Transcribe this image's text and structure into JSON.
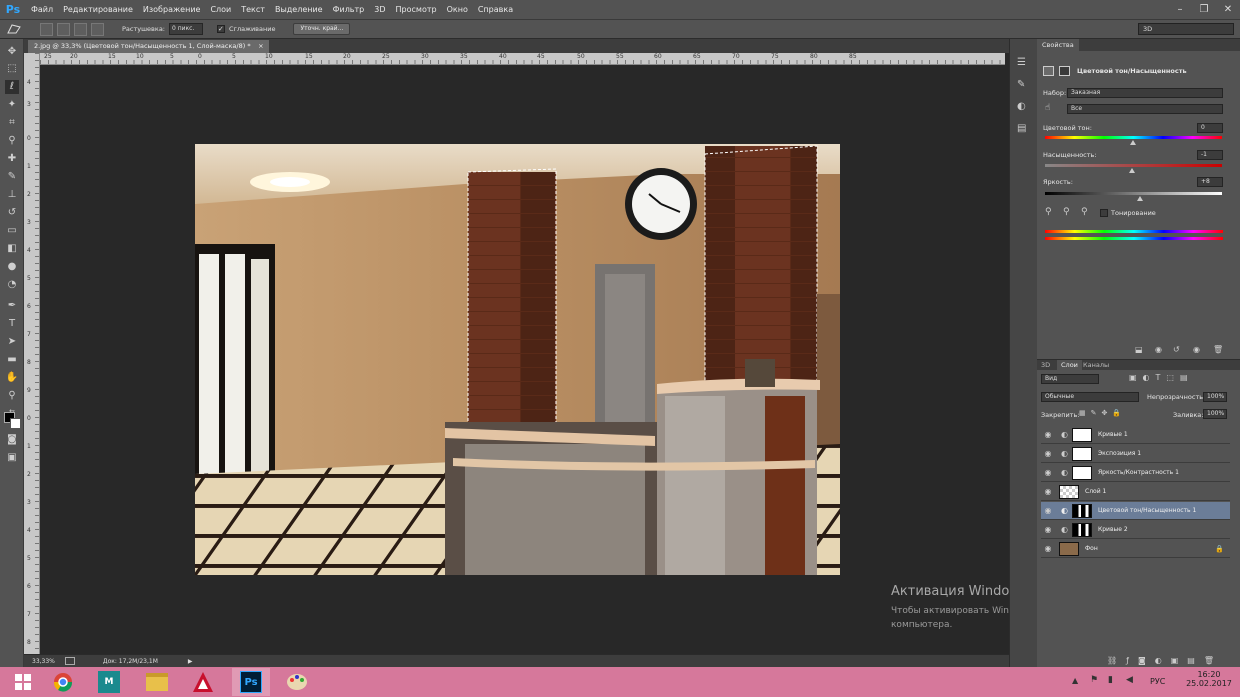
{
  "app": {
    "logo": "Ps",
    "accent": "#31a8ff"
  },
  "menu": [
    "Файл",
    "Редактирование",
    "Изображение",
    "Слои",
    "Текст",
    "Выделение",
    "Фильтр",
    "3D",
    "Просмотр",
    "Окно",
    "Справка"
  ],
  "window_controls": {
    "minimize": "–",
    "restore": "❐",
    "close": "✕"
  },
  "options": {
    "feather_label": "Растушевка:",
    "feather_value": "0 пикс.",
    "antialias_label": "Сглаживание",
    "refine_button": "Уточн. край...",
    "workspace": "3D"
  },
  "document": {
    "tab_title": "2.jpg @ 33,3% (Цветовой тон/Насыщенность 1, Слой-маска/8) *",
    "close": "×"
  },
  "ruler_top_labels": [
    "25",
    "20",
    "15",
    "10",
    "5",
    "0",
    "5",
    "10",
    "15",
    "20",
    "25",
    "30",
    "35",
    "40",
    "45",
    "50",
    "55",
    "60",
    "65",
    "70",
    "75",
    "80",
    "85"
  ],
  "ruler_left_labels": [
    "4",
    "3",
    "0",
    "1",
    "2",
    "3",
    "4",
    "5",
    "6",
    "7",
    "8",
    "9",
    "0",
    "1",
    "2",
    "3",
    "4",
    "5",
    "6",
    "7",
    "8"
  ],
  "status": {
    "zoom": "33,33%",
    "doc": "Док: 17,2M/23,1M",
    "arrow": "▶"
  },
  "properties": {
    "tabs": [
      "Свойства"
    ],
    "header": "Цветовой тон/Насыщенность",
    "preset_label": "Набор:",
    "preset_value": "Заказная",
    "channel_value": "Все",
    "hue_label": "Цветовой тон:",
    "hue_value": "0",
    "saturation_label": "Насыщенность:",
    "saturation_value": "-1",
    "lightness_label": "Яркость:",
    "lightness_value": "+8",
    "colorize_label": "Тонирование"
  },
  "layers_panel": {
    "tabs": [
      "3D",
      "Слои",
      "Каналы"
    ],
    "filter_value": "Вид",
    "blend_mode": "Обычные",
    "opacity_label": "Непрозрачность:",
    "opacity_value": "100%",
    "lock_label": "Закрепить:",
    "fill_label": "Заливка:",
    "fill_value": "100%",
    "layers": [
      {
        "name": "Кривые 1",
        "type": "adjustment",
        "selected": false
      },
      {
        "name": "Экспозиция 1",
        "type": "adjustment",
        "selected": false
      },
      {
        "name": "Яркость/Контрастность 1",
        "type": "adjustment",
        "selected": false
      },
      {
        "name": "Слой 1",
        "type": "pixel",
        "selected": false
      },
      {
        "name": "Цветовой тон/Насыщенность 1",
        "type": "adjustment",
        "selected": true
      },
      {
        "name": "Кривые 2",
        "type": "adjustment",
        "selected": false
      },
      {
        "name": "Фон",
        "type": "background",
        "selected": false
      }
    ]
  },
  "watermark": {
    "title": "Активация Windows",
    "line1": "Чтобы активировать Windows, перейдите к параметрам",
    "line2": "компьютера."
  },
  "taskbar": {
    "apps": [
      "windows-start-icon",
      "chrome-icon",
      "3dsmax-icon",
      "folder-icon",
      "autocad-icon",
      "photoshop-icon",
      "paint-icon"
    ],
    "lang": "РУС",
    "time": "16:20",
    "date": "25.02.2017"
  }
}
